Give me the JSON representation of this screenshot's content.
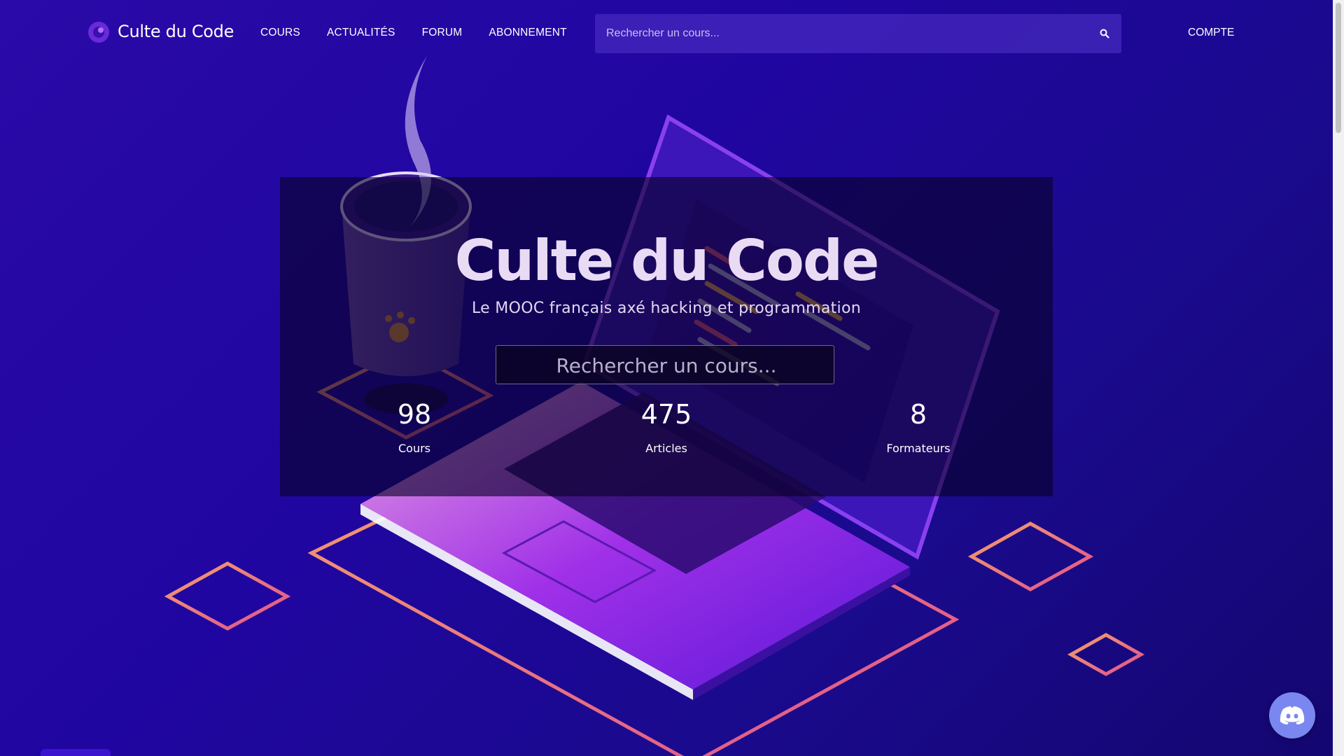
{
  "brand": {
    "name": "Culte du Code"
  },
  "nav": {
    "items": [
      "COURS",
      "ACTUALITÉS",
      "FORUM",
      "ABONNEMENT"
    ],
    "search_placeholder": "Rechercher un cours...",
    "account_label": "COMPTE"
  },
  "hero": {
    "title": "Culte du Code",
    "subtitle": "Le MOOC français axé hacking et programmation",
    "search_placeholder": "Rechercher un cours...",
    "stats": [
      {
        "value": "98",
        "label": "Cours"
      },
      {
        "value": "475",
        "label": "Articles"
      },
      {
        "value": "8",
        "label": "Formateurs"
      }
    ]
  },
  "icons": {
    "search": "search-icon",
    "discord": "discord-icon",
    "logo": "logo-icon"
  },
  "colors": {
    "background": "#2006a0",
    "accent_orange": "#f0a070",
    "accent_pink": "#e06090",
    "panel": "#080228",
    "discord": "#7a87f0"
  }
}
